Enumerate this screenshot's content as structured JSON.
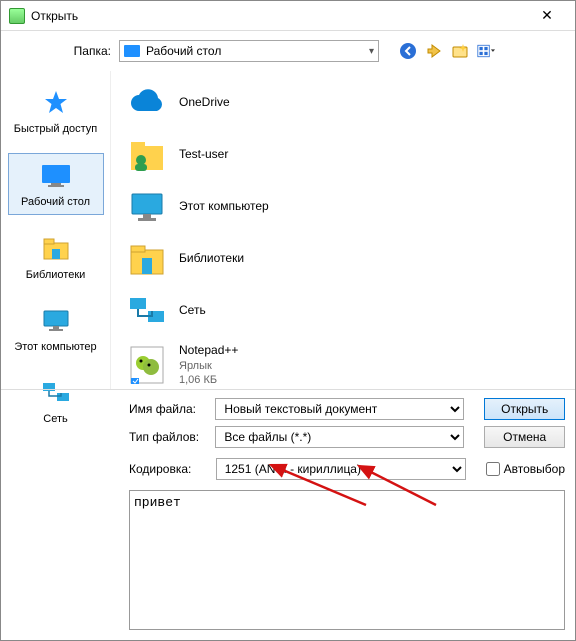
{
  "title": "Открыть",
  "folderLabel": "Папка:",
  "folderValue": "Рабочий стол",
  "sidebar": [
    {
      "name": "quick-access",
      "label": "Быстрый доступ"
    },
    {
      "name": "desktop",
      "label": "Рабочий стол"
    },
    {
      "name": "libraries",
      "label": "Библиотеки"
    },
    {
      "name": "this-pc",
      "label": "Этот компьютер"
    },
    {
      "name": "network",
      "label": "Сеть"
    }
  ],
  "files": [
    {
      "name": "onedrive",
      "label": "OneDrive",
      "sub": ""
    },
    {
      "name": "user",
      "label": "Test-user",
      "sub": ""
    },
    {
      "name": "this-pc",
      "label": "Этот компьютер",
      "sub": ""
    },
    {
      "name": "libraries",
      "label": "Библиотеки",
      "sub": ""
    },
    {
      "name": "network",
      "label": "Сеть",
      "sub": ""
    },
    {
      "name": "npp",
      "label": "Notepad++",
      "sub": "Ярлык",
      "size": "1,06 КБ"
    }
  ],
  "labels": {
    "filename": "Имя файла:",
    "filetype": "Тип файлов:",
    "encoding": "Кодировка:",
    "open": "Открыть",
    "cancel": "Отмена",
    "auto": "Автовыбор"
  },
  "values": {
    "filename": "Новый текстовый документ",
    "filetype": "Все файлы (*.*)",
    "encoding": "1251  (ANSI - кириллица)"
  },
  "preview": "привет"
}
